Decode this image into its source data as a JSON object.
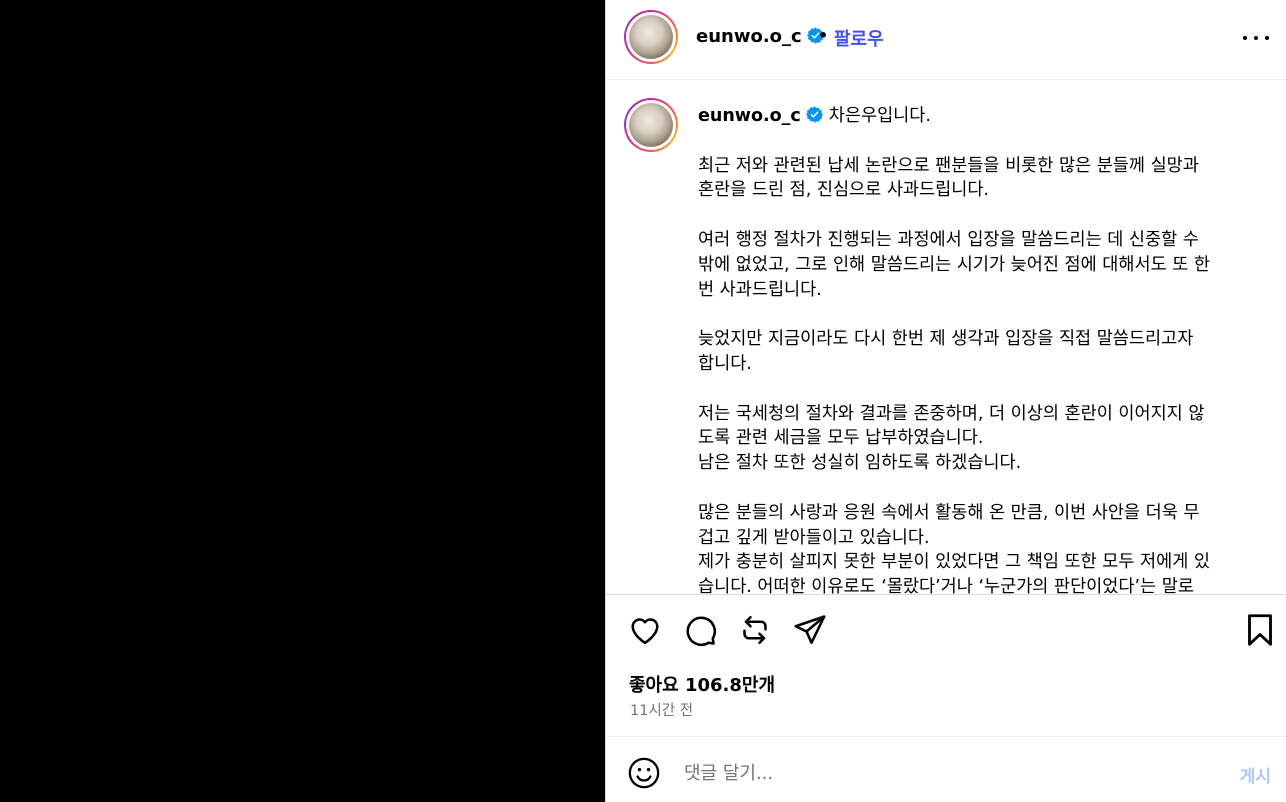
{
  "post": {
    "username": "eunwo.o_c",
    "follow_label": "팔로우",
    "separator": "•",
    "caption_intro": "차은우입니다.",
    "caption_paragraphs": [
      "최근 저와 관련된 납세 논란으로 팬분들을 비롯한 많은 분들께 실망과\n혼란을 드린 점, 진심으로 사과드립니다.",
      "여러 행정 절차가 진행되는 과정에서 입장을 말씀드리는 데 신중할 수\n밖에 없었고, 그로 인해 말씀드리는 시기가 늦어진 점에 대해서도 또 한\n번 사과드립니다.",
      "늦었지만 지금이라도 다시 한번 제 생각과 입장을 직접 말씀드리고자\n합니다.",
      "저는 국세청의 절차와 결과를 존중하며, 더 이상의 혼란이 이어지지 않\n도록 관련 세금을 모두 납부하였습니다.\n남은 절차 또한 성실히 임하도록 하겠습니다.",
      "많은 분들의 사랑과 응원 속에서 활동해 온 만큼, 이번 사안을 더욱 무\n겁고 깊게 받아들이고 있습니다.\n제가 충분히 살피지 못한 부분이 있었다면 그 책임 또한 모두 저에게 있\n습니다. 어떠한 이유로도 ‘몰랐다’거나 ‘누군가의 판단이었다’는 말로"
    ],
    "likes": "좋아요 106.8만개",
    "time_ago": "11시간 전"
  },
  "comment": {
    "placeholder": "댓글 달기...",
    "post_label": "게시"
  },
  "icons": [
    "verified-badge-icon",
    "more-options-icon",
    "heart-icon",
    "comment-icon",
    "repost-icon",
    "share-icon",
    "bookmark-icon",
    "emoji-icon"
  ],
  "colors": {
    "follow": "#4150f7",
    "verified": "#0095f6",
    "post_disabled": "#b3c6f7",
    "muted_text": "#737373"
  }
}
